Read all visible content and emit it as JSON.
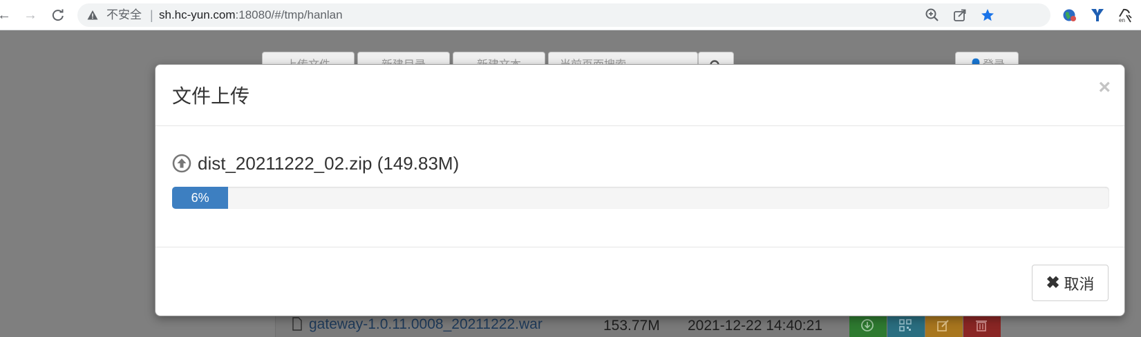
{
  "browser": {
    "insecure_label": "不安全",
    "separator": "|",
    "url_host": "sh.hc-yun.com",
    "url_path": ":18080/#/tmp/hanlan",
    "icons": [
      "back-icon",
      "forward-icon",
      "reload-icon",
      "warning-icon",
      "zoom-icon",
      "share-icon",
      "bookmark-star-icon",
      "extension-globe-icon",
      "extension-y-icon",
      "extension-translate-icon"
    ]
  },
  "background": {
    "toolbar_buttons": [
      "上传文件",
      "新建目录",
      "新建文本",
      "当前页面搜索",
      "登录"
    ],
    "file_row": {
      "name": "gateway-1.0.11.0008_20211222.war",
      "size": "153.77M",
      "date": "2021-12-22 14:40:21",
      "actions": [
        {
          "name": "download",
          "color": "#2e7a30"
        },
        {
          "name": "qrcode",
          "color": "#2a6e80"
        },
        {
          "name": "edit",
          "color": "#a8761e"
        },
        {
          "name": "delete",
          "color": "#8a2624"
        }
      ]
    }
  },
  "modal": {
    "title": "文件上传",
    "close_symbol": "×",
    "file_label": "dist_20211222_02.zip (149.83M)",
    "progress_percent": 6,
    "progress_text": "6%",
    "cancel_symbol": "✖",
    "cancel_label": "取消"
  },
  "colors": {
    "progress": "#3d7fc1",
    "bookmark_star": "#1a73e8"
  }
}
